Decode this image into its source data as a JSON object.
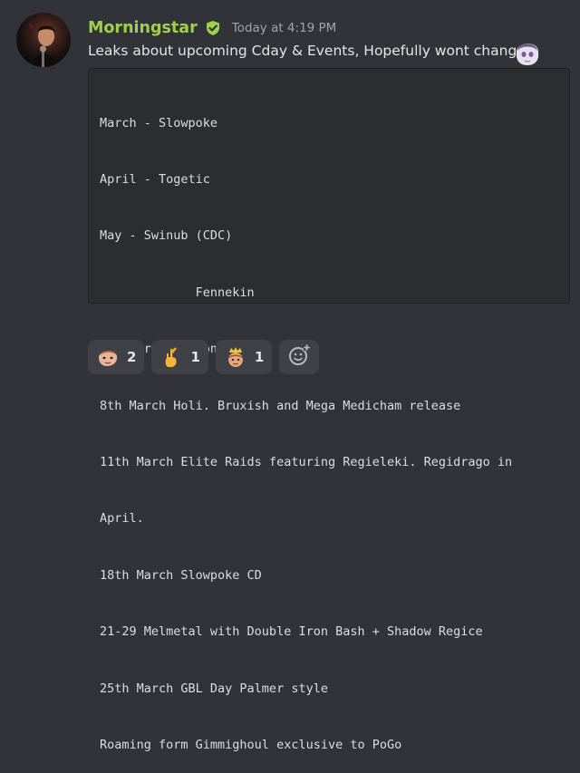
{
  "message": {
    "author": "Morningstar",
    "timestamp": "Today at 4:19 PM",
    "text": "Leaks about upcoming Cday & Events, Hopefully wont change",
    "code_lines": [
      "March - Slowpoke",
      "April - Togetic",
      "May - Swinub (CDC)",
      "             Fennekin",
      "5th March Hitmon event.",
      "8th March Holi. Bruxish and Mega Medicham release",
      "11th March Elite Raids featuring Regieleki. Regidrago in",
      "April.",
      "18th March Slowpoke CD",
      "21-29 Melmetal with Double Iron Bash + Shadow Regice",
      "25th March GBL Day Palmer style",
      "Roaming form Gimmighoul exclusive to PoGo"
    ]
  },
  "badge_icon": "shield-check-icon",
  "badge_color": "#9fd04b",
  "username_color": "#9fd04b",
  "reactions": [
    {
      "icon": "face-emote-icon",
      "count": "2"
    },
    {
      "icon": "crossed-fingers-icon",
      "count": "1"
    },
    {
      "icon": "crowned-face-icon",
      "count": "1"
    }
  ],
  "add_reaction_icon": "add-reaction-icon"
}
